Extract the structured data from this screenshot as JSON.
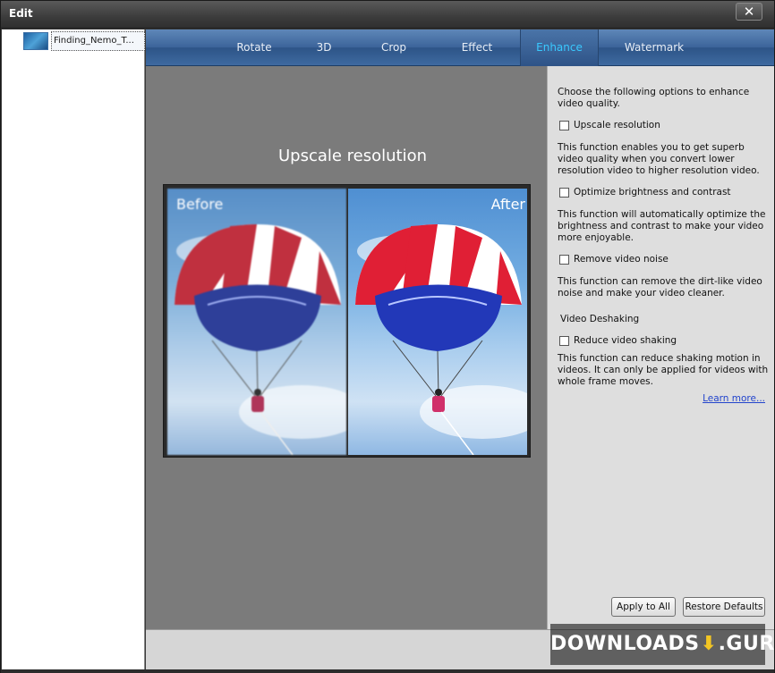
{
  "window": {
    "title": "Edit",
    "close_symbol": "✕"
  },
  "sidebar": {
    "items": [
      {
        "label": "Finding_Nemo_T..."
      }
    ]
  },
  "tabs": [
    {
      "label": "Rotate"
    },
    {
      "label": "3D"
    },
    {
      "label": "Crop"
    },
    {
      "label": "Effect"
    },
    {
      "label": "Enhance",
      "active": true
    },
    {
      "label": "Watermark"
    }
  ],
  "preview": {
    "title": "Upscale resolution",
    "before_label": "Before",
    "after_label": "After"
  },
  "options": {
    "intro": "Choose the following options to enhance video quality.",
    "upscale": {
      "label": "Upscale resolution",
      "checked": false,
      "desc": "This function enables you to get superb video quality when you convert lower resolution video to higher resolution video."
    },
    "brightness": {
      "label": "Optimize brightness and contrast",
      "checked": false,
      "desc": "This function will automatically optimize the brightness and contrast to make your video more enjoyable."
    },
    "noise": {
      "label": "Remove video noise",
      "checked": false,
      "desc": "This function can remove the dirt-like video noise and make your video cleaner."
    },
    "deshake_section": "Video Deshaking",
    "deshake": {
      "label": "Reduce video shaking",
      "checked": false,
      "desc": "This function can reduce shaking motion in videos. It can only be applied for videos with whole frame moves."
    },
    "learn_more": "Learn more...",
    "apply_all": "Apply to All",
    "restore_defaults": "Restore Defaults"
  },
  "watermark": {
    "text_left": "DOWNLOADS",
    "text_right": ".GURU"
  },
  "colors": {
    "accent_tab": "#39c9ff",
    "tabbar": "#3c649a",
    "preview_bg": "#7b7b7b",
    "link": "#2244cc"
  }
}
